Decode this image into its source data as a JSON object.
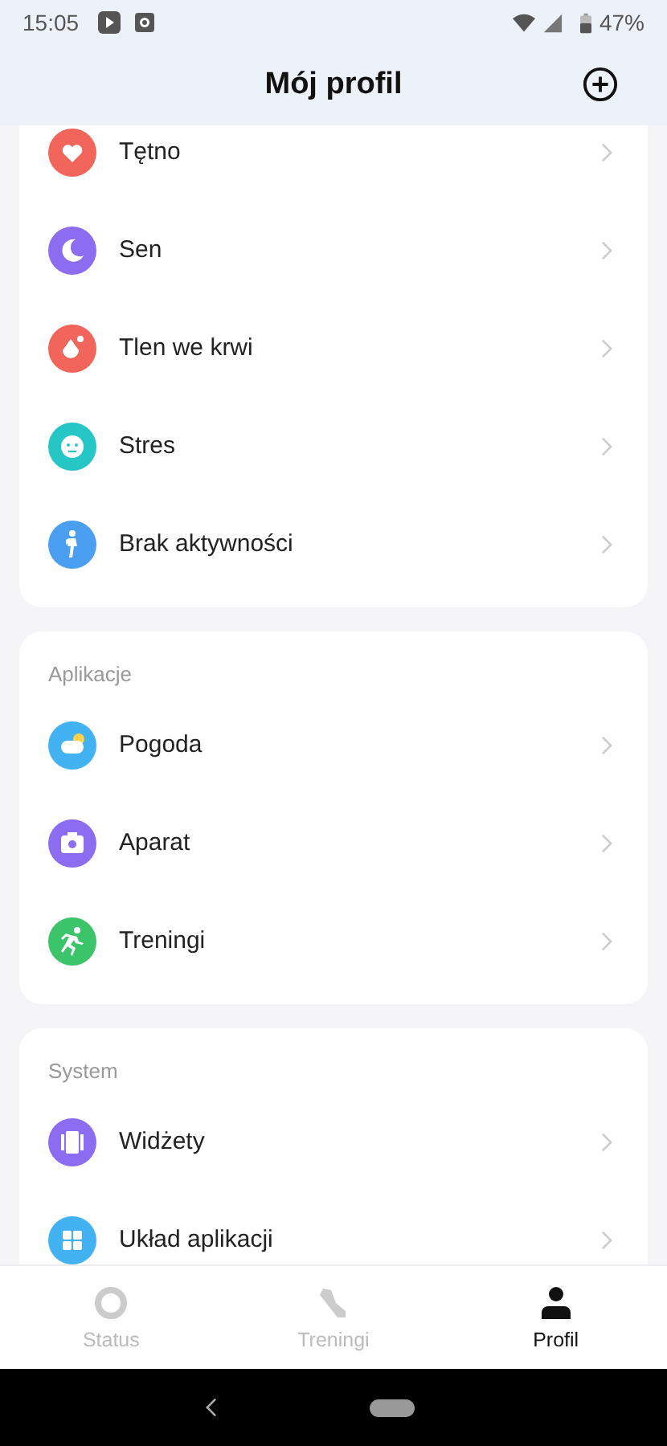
{
  "status_bar": {
    "time": "15:05",
    "battery": "47%"
  },
  "header": {
    "title": "Mój profil"
  },
  "sections": [
    {
      "items": [
        {
          "label": "Tętno",
          "kind": "heart",
          "color": "#f2655a"
        },
        {
          "label": "Sen",
          "kind": "moon",
          "color": "#8c6cf0"
        },
        {
          "label": "Tlen we krwi",
          "kind": "drop",
          "color": "#f2655a"
        },
        {
          "label": "Stres",
          "kind": "face",
          "color": "#26c6c6"
        },
        {
          "label": "Brak aktywności",
          "kind": "walker",
          "color": "#4a9ff0"
        }
      ]
    },
    {
      "title": "Aplikacje",
      "items": [
        {
          "label": "Pogoda",
          "kind": "weather",
          "color": "#43b2f2"
        },
        {
          "label": "Aparat",
          "kind": "camera",
          "color": "#8c6cf0"
        },
        {
          "label": "Treningi",
          "kind": "runner",
          "color": "#3cc46a"
        }
      ]
    },
    {
      "title": "System",
      "items": [
        {
          "label": "Widżety",
          "kind": "widgets",
          "color": "#8c6cf0"
        },
        {
          "label": "Układ aplikacji",
          "kind": "grid",
          "color": "#43b2f2"
        }
      ]
    }
  ],
  "bottom_nav": [
    {
      "label": "Status",
      "kind": "ring",
      "selected": false
    },
    {
      "label": "Treningi",
      "kind": "shoe",
      "selected": false
    },
    {
      "label": "Profil",
      "kind": "person",
      "selected": true
    }
  ]
}
